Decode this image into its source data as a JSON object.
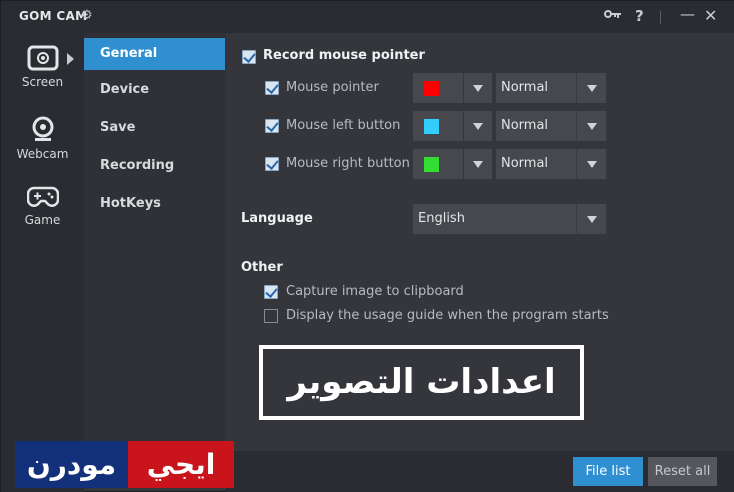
{
  "window": {
    "title": "GOM CAM",
    "icons": [
      "gear-icon",
      "key-icon",
      "help-icon",
      "minimize-icon",
      "close-icon"
    ],
    "help_glyph": "?",
    "close_glyph": "✕",
    "minimize_glyph": "—"
  },
  "nav": {
    "modes": [
      {
        "label": "Screen",
        "icon": "screen-record-icon"
      },
      {
        "label": "Webcam",
        "icon": "webcam-icon"
      },
      {
        "label": "Game",
        "icon": "gamepad-icon"
      }
    ]
  },
  "categories": [
    {
      "label": "General",
      "active": true
    },
    {
      "label": "Device",
      "active": false
    },
    {
      "label": "Save",
      "active": false
    },
    {
      "label": "Recording",
      "active": false
    },
    {
      "label": "HotKeys",
      "active": false
    }
  ],
  "general": {
    "record_mouse_pointer": {
      "label": "Record mouse pointer",
      "checked": true
    },
    "mouse_rows": [
      {
        "label": "Mouse pointer",
        "checked": true,
        "color": "#ff0000",
        "mode": "Normal"
      },
      {
        "label": "Mouse left button",
        "checked": true,
        "color": "#33ccff",
        "mode": "Normal"
      },
      {
        "label": "Mouse right button",
        "checked": true,
        "color": "#33dd33",
        "mode": "Normal"
      }
    ],
    "language": {
      "label": "Language",
      "value": "English"
    },
    "other": {
      "heading": "Other",
      "capture_clipboard": {
        "label": "Capture image to clipboard",
        "checked": true
      },
      "usage_guide": {
        "label": "Display the usage guide when the program starts",
        "checked": false
      }
    }
  },
  "footer": {
    "file_list": "File list",
    "reset_all": "Reset all"
  },
  "overlay": {
    "banner_text": "اعدادات التصوير",
    "logo_blue_text": "مودرن",
    "logo_red_text": "ايجي"
  },
  "colors": {
    "accent": "#2f8fd0",
    "background": "#34363c",
    "sidebar": "#2a2c31"
  }
}
